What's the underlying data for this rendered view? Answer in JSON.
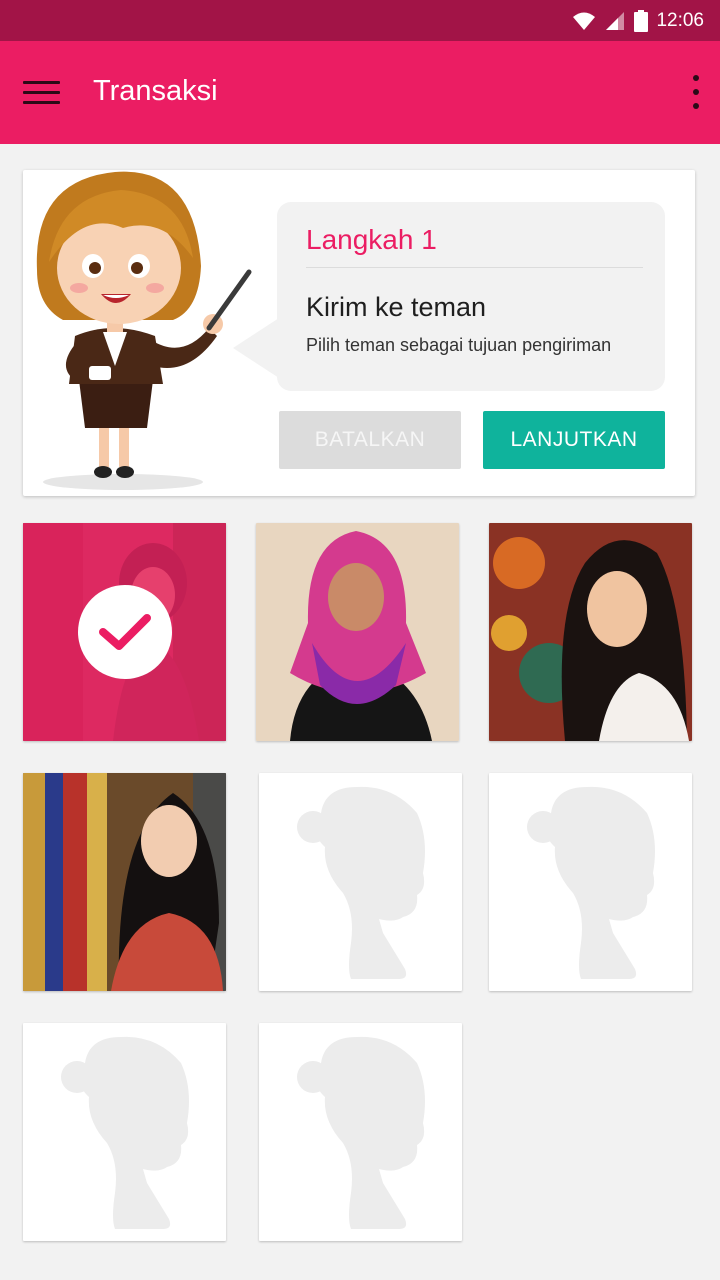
{
  "status_bar": {
    "time": "12:06",
    "icons": [
      "wifi-icon",
      "signal-icon",
      "battery-icon"
    ]
  },
  "app_bar": {
    "title": "Transaksi",
    "menu_icon": "hamburger-menu-icon",
    "overflow_icon": "more-vert-icon"
  },
  "instruction": {
    "step_label": "Langkah 1",
    "title": "Kirim ke teman",
    "description": "Pilih teman sebagai tujuan pengiriman",
    "cancel_label": "BATALKAN",
    "continue_label": "LANJUTKAN"
  },
  "friends": [
    {
      "type": "photo",
      "selected": true,
      "icon": "check-icon"
    },
    {
      "type": "photo",
      "selected": false
    },
    {
      "type": "photo",
      "selected": false
    },
    {
      "type": "photo",
      "selected": false
    },
    {
      "type": "placeholder",
      "selected": false,
      "icon": "woman-silhouette-icon"
    },
    {
      "type": "placeholder",
      "selected": false,
      "icon": "woman-silhouette-icon"
    },
    {
      "type": "placeholder",
      "selected": false,
      "icon": "woman-silhouette-icon"
    },
    {
      "type": "placeholder",
      "selected": false,
      "icon": "woman-silhouette-icon"
    }
  ],
  "colors": {
    "status_bar": "#a21447",
    "primary": "#eb1d63",
    "accent": "#0fb39c",
    "disabled_button": "#dcdcdc",
    "background": "#f2f2f2"
  }
}
